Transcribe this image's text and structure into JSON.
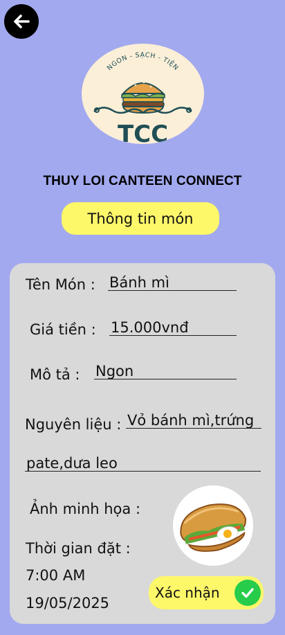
{
  "header": {
    "back_icon": "arrow-left-icon",
    "logo": {
      "ribbon_text": "NGON - SẠCH - TIỆN",
      "monogram": "TCC"
    },
    "app_title": "THUY LOI CANTEEN CONNECT"
  },
  "section": {
    "title": "Thông tin món"
  },
  "form": {
    "name_label": "Tên Món :",
    "name_value": "Bánh mì",
    "price_label": "Giá tiền :",
    "price_value": "15.000vnđ",
    "desc_label": "Mô tả :",
    "desc_value": "Ngon",
    "ingredients_label": "Nguyên liệu :",
    "ingredients_line1": "Vỏ bánh mì,trứng",
    "ingredients_line2": "pate,dưa leo",
    "image_label": "Ảnh minh họa :",
    "time_label": "Thời gian đặt :",
    "time_value": "7:00 AM",
    "date_value": "19/05/2025"
  },
  "actions": {
    "confirm_label": "Xác nhận",
    "confirm_icon": "check-circle-icon"
  },
  "colors": {
    "background": "#a2a9ee",
    "card": "#d9d9d9",
    "pill": "#fdf76a",
    "confirm_check": "#26cc4a",
    "logo_teal": "#1f4f55"
  }
}
